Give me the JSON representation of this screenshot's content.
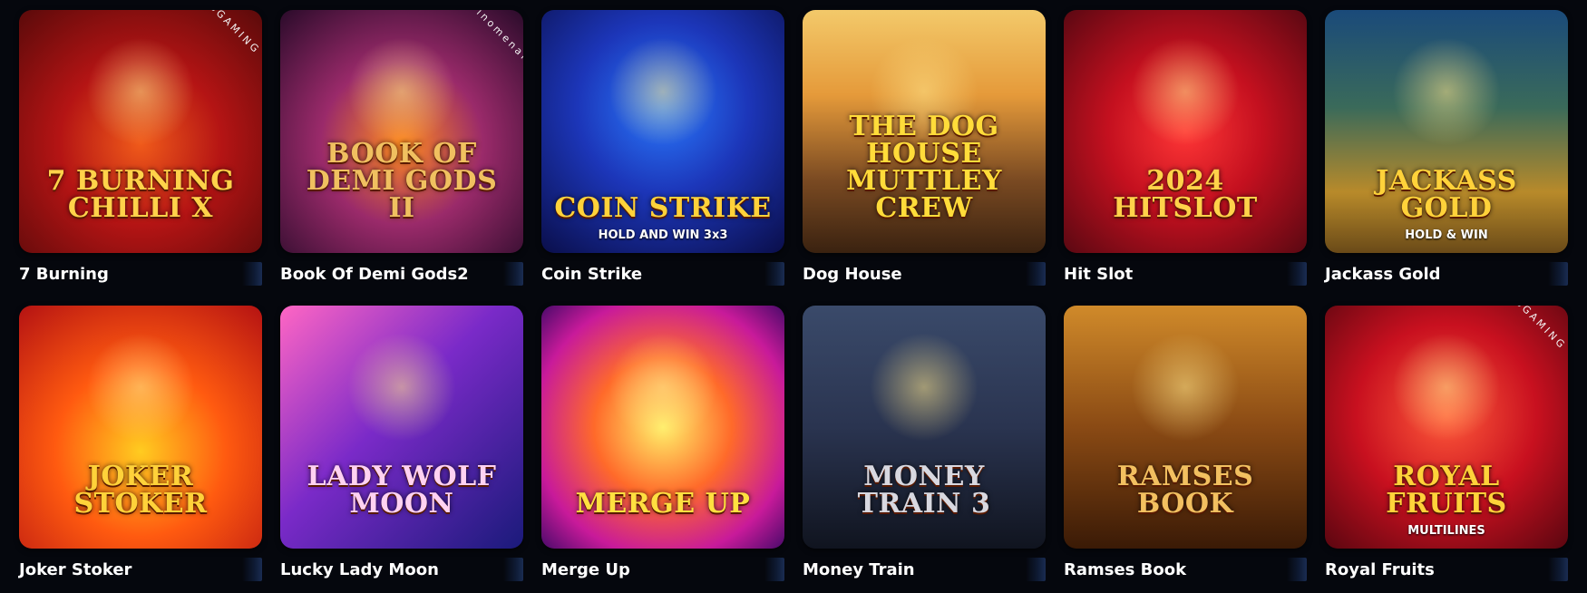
{
  "games": [
    {
      "name": "7 Burning",
      "logo": "7 BURNING CHILLI X",
      "sub": "",
      "provider": "BGAMING",
      "icon": "chili-pepper-icon",
      "logo_color": "#ffd24a"
    },
    {
      "name": "Book Of Demi Gods2",
      "logo": "BOOK OF DEMI GODS II",
      "sub": "",
      "provider": "Spinomenal",
      "icon": "book-icon",
      "logo_color": "#f0c060"
    },
    {
      "name": "Coin Strike",
      "logo": "COIN STRIKE",
      "sub": "HOLD AND WIN 3x3",
      "provider": "",
      "icon": "lightning-coin-icon",
      "logo_color": "#ffd23a"
    },
    {
      "name": "Dog House",
      "logo": "THE DOG HOUSE MUTTLEY CREW",
      "sub": "",
      "provider": "",
      "icon": "pirate-dog-icon",
      "logo_color": "#ffdc3a"
    },
    {
      "name": "Hit Slot",
      "logo": "2024 HITSLOT",
      "sub": "",
      "provider": "",
      "icon": "jester-star-icon",
      "logo_color": "#ffd24a"
    },
    {
      "name": "Jackass Gold",
      "logo": "JACKASS GOLD",
      "sub": "HOLD & WIN",
      "provider": "",
      "icon": "donkey-icon",
      "logo_color": "#ffd23a"
    },
    {
      "name": "Joker Stoker",
      "logo": "JOKER STOKER",
      "sub": "",
      "provider": "",
      "icon": "joker-icon",
      "logo_color": "#ffd23a"
    },
    {
      "name": "Lucky Lady Moon",
      "logo": "Lady Wolf Moon",
      "sub": "",
      "provider": "",
      "icon": "wolf-icon",
      "logo_color": "#ffd2f2"
    },
    {
      "name": "Merge Up",
      "logo": "MERGE UP",
      "sub": "",
      "provider": "",
      "icon": "gem-icon",
      "logo_color": "#ffe040"
    },
    {
      "name": "Money Train",
      "logo": "MONEY TRAIN 3",
      "sub": "",
      "provider": "",
      "icon": "train-icon",
      "logo_color": "#d8d8e0"
    },
    {
      "name": "Ramses Book",
      "logo": "RAMSES BOOK",
      "sub": "",
      "provider": "",
      "icon": "pharaoh-icon",
      "logo_color": "#f2c060"
    },
    {
      "name": "Royal Fruits",
      "logo": "ROYAL FRUITS",
      "sub": "MULTILINES",
      "provider": "BGAMING",
      "icon": "crown-icon",
      "logo_color": "#ffd23a"
    }
  ]
}
